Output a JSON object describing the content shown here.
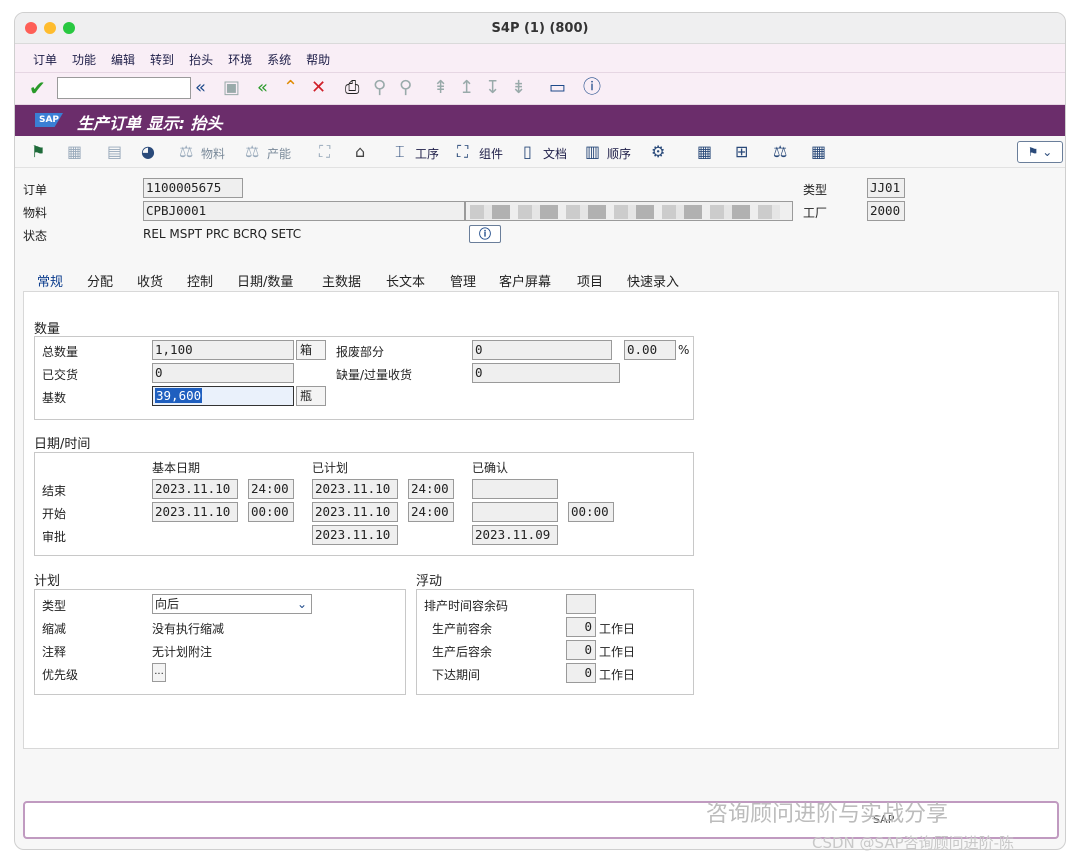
{
  "window": {
    "title": "S4P (1) (800)"
  },
  "menu": [
    "订单",
    "功能",
    "编辑",
    "转到",
    "抬头",
    "环境",
    "系统",
    "帮助"
  ],
  "header": {
    "title": "生产订单 显示: 抬头",
    "logo": "SAP"
  },
  "app_toolbar": {
    "material_label": "物料",
    "capacity_label": "产能",
    "operations_label": "工序",
    "components_label": "组件",
    "documents_label": "文档",
    "sequences_label": "顺序"
  },
  "order": {
    "order_label": "订单",
    "order_value": "1100005675",
    "material_label": "物料",
    "material_value": "CPBJ0001",
    "status_label": "状态",
    "status_value": "REL  MSPT PRC  BCRQ SETC",
    "type_label": "类型",
    "type_value": "JJ01",
    "plant_label": "工厂",
    "plant_value": "2000"
  },
  "tabs": [
    "常规",
    "分配",
    "收货",
    "控制",
    "日期/数量",
    "主数据",
    "长文本",
    "管理",
    "客户屏幕",
    "项目",
    "快速录入"
  ],
  "quantity": {
    "title": "数量",
    "total_label": "总数量",
    "total_value": "1,100",
    "total_unit": "箱",
    "scrap_label": "报废部分",
    "scrap_value": "0",
    "scrap_pct": "0.00",
    "pct_sign": "%",
    "delivered_label": "已交货",
    "delivered_value": "0",
    "shortage_label": "缺量/过量收货",
    "shortage_value": "0",
    "base_label": "基数",
    "base_value": "39,600",
    "base_unit": "瓶"
  },
  "dates": {
    "title": "日期/时间",
    "col_basic": "基本日期",
    "col_planned": "已计划",
    "col_confirmed": "已确认",
    "end_label": "结束",
    "end_basic_date": "2023.11.10",
    "end_basic_time": "24:00",
    "end_planned_date": "2023.11.10",
    "end_planned_time": "24:00",
    "end_confirmed": "",
    "start_label": "开始",
    "start_basic_date": "2023.11.10",
    "start_basic_time": "00:00",
    "start_planned_date": "2023.11.10",
    "start_planned_time": "24:00",
    "start_confirmed": "",
    "start_confirmed_time": "00:00",
    "release_label": "审批",
    "release_planned_date": "2023.11.10",
    "release_confirmed_date": "2023.11.09"
  },
  "planning": {
    "title": "计划",
    "type_label": "类型",
    "type_value": "向后",
    "reduction_label": "缩减",
    "reduction_value": "没有执行缩减",
    "note_label": "注释",
    "note_value": "无计划附注",
    "priority_label": "优先级",
    "priority_button": "..."
  },
  "float": {
    "title": "浮动",
    "sched_margin_label": "排产时间容余码",
    "sched_margin_value": "",
    "before_label": "生产前容余",
    "before_value": "0",
    "after_label": "生产后容余",
    "after_value": "0",
    "release_label": "下达期间",
    "release_value": "0",
    "unit": "工作日"
  },
  "status_bar": {
    "text": "SAP"
  },
  "watermark": {
    "line1": "咨询顾问进阶与实战分享",
    "line2": "CSDN @SAP咨询顾问进阶-陈"
  },
  "colors": {
    "sap_bar": "#6b2d6b",
    "menu_bg": "#f9eef6",
    "accent_blue": "#0a5bb5"
  }
}
